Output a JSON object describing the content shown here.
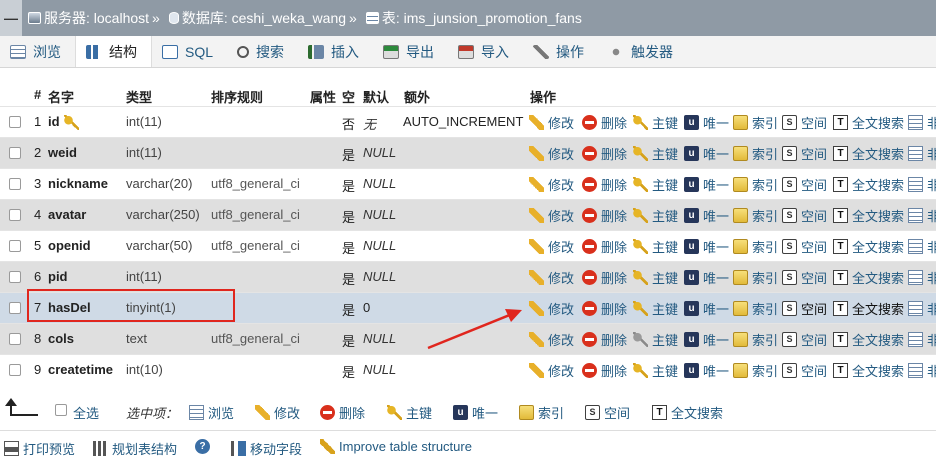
{
  "breadcrumb": {
    "server_label": "服务器: localhost",
    "sep": "»",
    "db_label": "数据库: ceshi_weka_wang",
    "table_label": "表: ims_junsion_promotion_fans",
    "minimize_glyph": "—"
  },
  "tabs": [
    {
      "label": "浏览",
      "icon": "browse-icon"
    },
    {
      "label": "结构",
      "icon": "structure-icon"
    },
    {
      "label": "SQL",
      "icon": "sql-icon"
    },
    {
      "label": "搜索",
      "icon": "search-icon"
    },
    {
      "label": "插入",
      "icon": "insert-icon"
    },
    {
      "label": "导出",
      "icon": "export-icon"
    },
    {
      "label": "导入",
      "icon": "import-icon"
    },
    {
      "label": "操作",
      "icon": "operations-icon"
    },
    {
      "label": "触发器",
      "icon": "triggers-icon"
    }
  ],
  "columns": {
    "num": "#",
    "name": "名字",
    "type": "类型",
    "collation": "排序规则",
    "attributes": "属性",
    "null": "空",
    "default": "默认",
    "extra": "额外",
    "action": "操作"
  },
  "actions": {
    "edit": "修改",
    "drop": "删除",
    "primary": "主键",
    "unique": "唯一",
    "index": "索引",
    "spatial": "空间",
    "fulltext": "全文搜索",
    "more": "非"
  },
  "rows": [
    {
      "num": "1",
      "name": "id",
      "type": "int(11)",
      "collation": "",
      "null": "否",
      "default": "无",
      "extra": "AUTO_INCREMENT"
    },
    {
      "num": "2",
      "name": "weid",
      "type": "int(11)",
      "collation": "",
      "null": "是",
      "default": "NULL",
      "extra": ""
    },
    {
      "num": "3",
      "name": "nickname",
      "type": "varchar(20)",
      "collation": "utf8_general_ci",
      "null": "是",
      "default": "NULL",
      "extra": ""
    },
    {
      "num": "4",
      "name": "avatar",
      "type": "varchar(250)",
      "collation": "utf8_general_ci",
      "null": "是",
      "default": "NULL",
      "extra": ""
    },
    {
      "num": "5",
      "name": "openid",
      "type": "varchar(50)",
      "collation": "utf8_general_ci",
      "null": "是",
      "default": "NULL",
      "extra": ""
    },
    {
      "num": "6",
      "name": "pid",
      "type": "int(11)",
      "collation": "",
      "null": "是",
      "default": "NULL",
      "extra": ""
    },
    {
      "num": "7",
      "name": "hasDel",
      "type": "tinyint(1)",
      "collation": "",
      "null": "是",
      "default": "0",
      "extra": ""
    },
    {
      "num": "8",
      "name": "cols",
      "type": "text",
      "collation": "utf8_general_ci",
      "null": "是",
      "default": "NULL",
      "extra": ""
    },
    {
      "num": "9",
      "name": "createtime",
      "type": "int(10)",
      "collation": "",
      "null": "是",
      "default": "NULL",
      "extra": ""
    }
  ],
  "bulk": {
    "check_all": "全选",
    "with_selected": "选中项：",
    "browse": "浏览",
    "edit": "修改",
    "drop": "删除",
    "primary": "主键",
    "unique": "唯一",
    "index": "索引",
    "spatial": "空间",
    "fulltext": "全文搜索"
  },
  "footer": {
    "print": "打印预览",
    "propose": "规划表结构",
    "help_glyph": "?",
    "move": "移动字段",
    "improve": "Improve table structure"
  },
  "colors": {
    "link": "#235a81",
    "titlebar": "#8f9aa5",
    "highlight_row": "#cfdae6",
    "annotation_red": "#e0261e"
  }
}
